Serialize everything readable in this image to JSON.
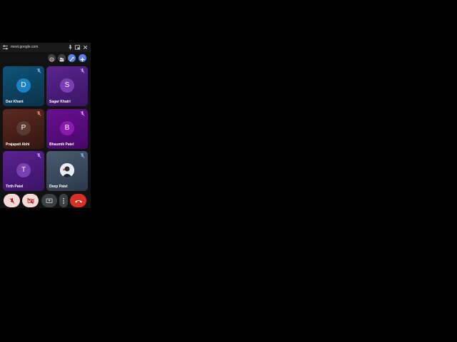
{
  "browser": {
    "url": "meet.google.com"
  },
  "participants": [
    {
      "name": "Dax Khant",
      "initial": "D",
      "tile_color": "#0d4a6b",
      "avatar_color": "#1b82c6",
      "muted": true
    },
    {
      "name": "Sagar Khatri",
      "initial": "S",
      "tile_color": "#4a1e78",
      "avatar_color": "#7a3fb4",
      "muted": true
    },
    {
      "name": "Prajapati Abhi",
      "initial": "P",
      "tile_color": "#4a231c",
      "avatar_color": "#5a3a33",
      "muted": true
    },
    {
      "name": "Bhaumik Patel",
      "initial": "B",
      "tile_color": "#5a0c7c",
      "avatar_color": "#8a1ab0",
      "muted": true
    },
    {
      "name": "Tirth Patel",
      "initial": "T",
      "tile_color": "#4c1c7a",
      "avatar_color": "#7a3fb0",
      "muted": true
    },
    {
      "name": "Deep Patel",
      "initial": "",
      "tile_color": "#3a4a5e",
      "avatar_color": "#dfe7ef",
      "muted": true
    }
  ],
  "colors": {
    "accent_blue": "#5a7ee6",
    "end_call_red": "#d93025",
    "control_light": "#f5d9d7",
    "control_dark": "#3c4043"
  },
  "icons": {
    "top_bar": [
      "tune-icon",
      "mic-icon",
      "picture-in-picture-icon",
      "close-icon"
    ],
    "header": [
      "record-icon",
      "people-icon",
      "effects-icon",
      "sparkle-icon"
    ],
    "controls": [
      "mic-off-icon",
      "camera-off-icon",
      "present-icon",
      "more-vert-icon",
      "call-end-icon"
    ]
  }
}
